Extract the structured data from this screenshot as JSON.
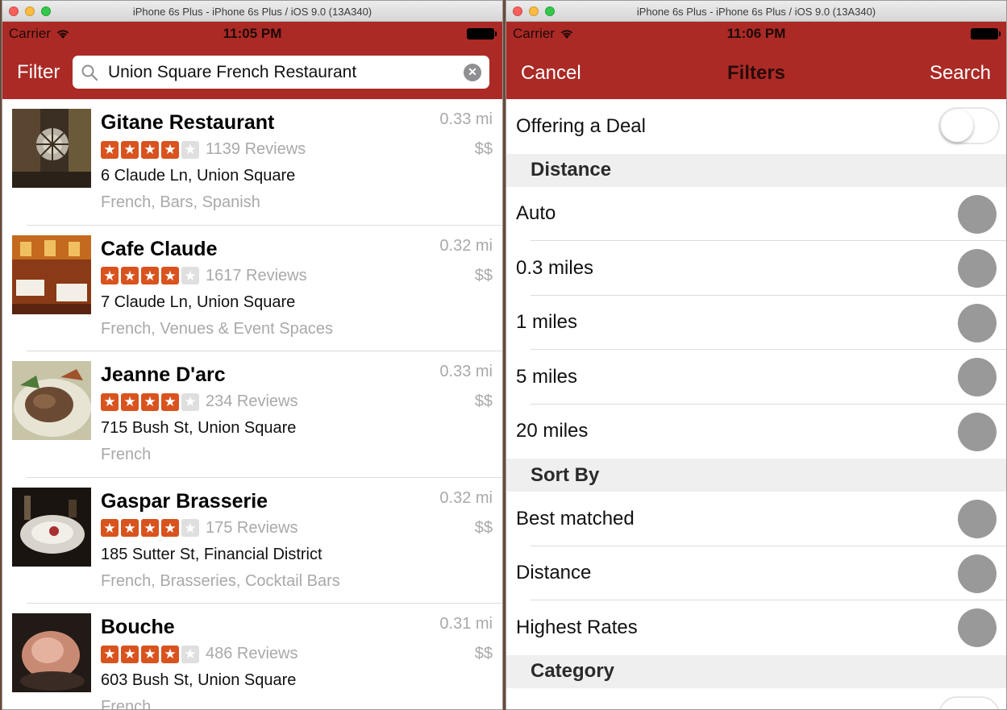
{
  "left_window": {
    "title": "iPhone 6s Plus - iPhone 6s Plus / iOS 9.0 (13A340)",
    "status": {
      "carrier": "Carrier",
      "time": "11:05 PM"
    },
    "nav": {
      "filter_label": "Filter"
    },
    "search": {
      "value": "Union Square French Restaurant",
      "clear_icon": "clear-icon",
      "search_icon": "search-icon"
    },
    "results": [
      {
        "name": "Gitane Restaurant",
        "distance": "0.33 mi",
        "rating": 4,
        "reviews": "1139 Reviews",
        "price": "$$",
        "address": "6 Claude Ln, Union Square",
        "categories": "French, Bars, Spanish"
      },
      {
        "name": "Cafe Claude",
        "distance": "0.32 mi",
        "rating": 4,
        "reviews": "1617 Reviews",
        "price": "$$",
        "address": "7 Claude Ln, Union Square",
        "categories": "French, Venues & Event Spaces"
      },
      {
        "name": "Jeanne D'arc",
        "distance": "0.33 mi",
        "rating": 4,
        "reviews": "234 Reviews",
        "price": "$$",
        "address": "715 Bush St, Union Square",
        "categories": "French"
      },
      {
        "name": "Gaspar Brasserie",
        "distance": "0.32 mi",
        "rating": 4,
        "reviews": "175 Reviews",
        "price": "$$",
        "address": "185 Sutter St, Financial District",
        "categories": "French, Brasseries, Cocktail Bars"
      },
      {
        "name": "Bouche",
        "distance": "0.31 mi",
        "rating": 4,
        "reviews": "486 Reviews",
        "price": "$$",
        "address": "603 Bush St, Union Square",
        "categories": "French"
      }
    ]
  },
  "right_window": {
    "title": "iPhone 6s Plus - iPhone 6s Plus / iOS 9.0 (13A340)",
    "status": {
      "carrier": "Carrier",
      "time": "11:06 PM"
    },
    "nav": {
      "cancel_label": "Cancel",
      "title": "Filters",
      "search_label": "Search"
    },
    "deal": {
      "label": "Offering a Deal",
      "on": false
    },
    "sections": {
      "distance": {
        "header": "Distance",
        "options": [
          "Auto",
          "0.3 miles",
          "1 miles",
          "5 miles",
          "20 miles"
        ]
      },
      "sort": {
        "header": "Sort By",
        "options": [
          "Best matched",
          "Distance",
          "Highest Rates"
        ]
      },
      "category": {
        "header": "Category"
      }
    }
  },
  "colors": {
    "nav_red": "#ab2a25",
    "star_orange": "#d9531e",
    "radio_gray": "#999999"
  }
}
